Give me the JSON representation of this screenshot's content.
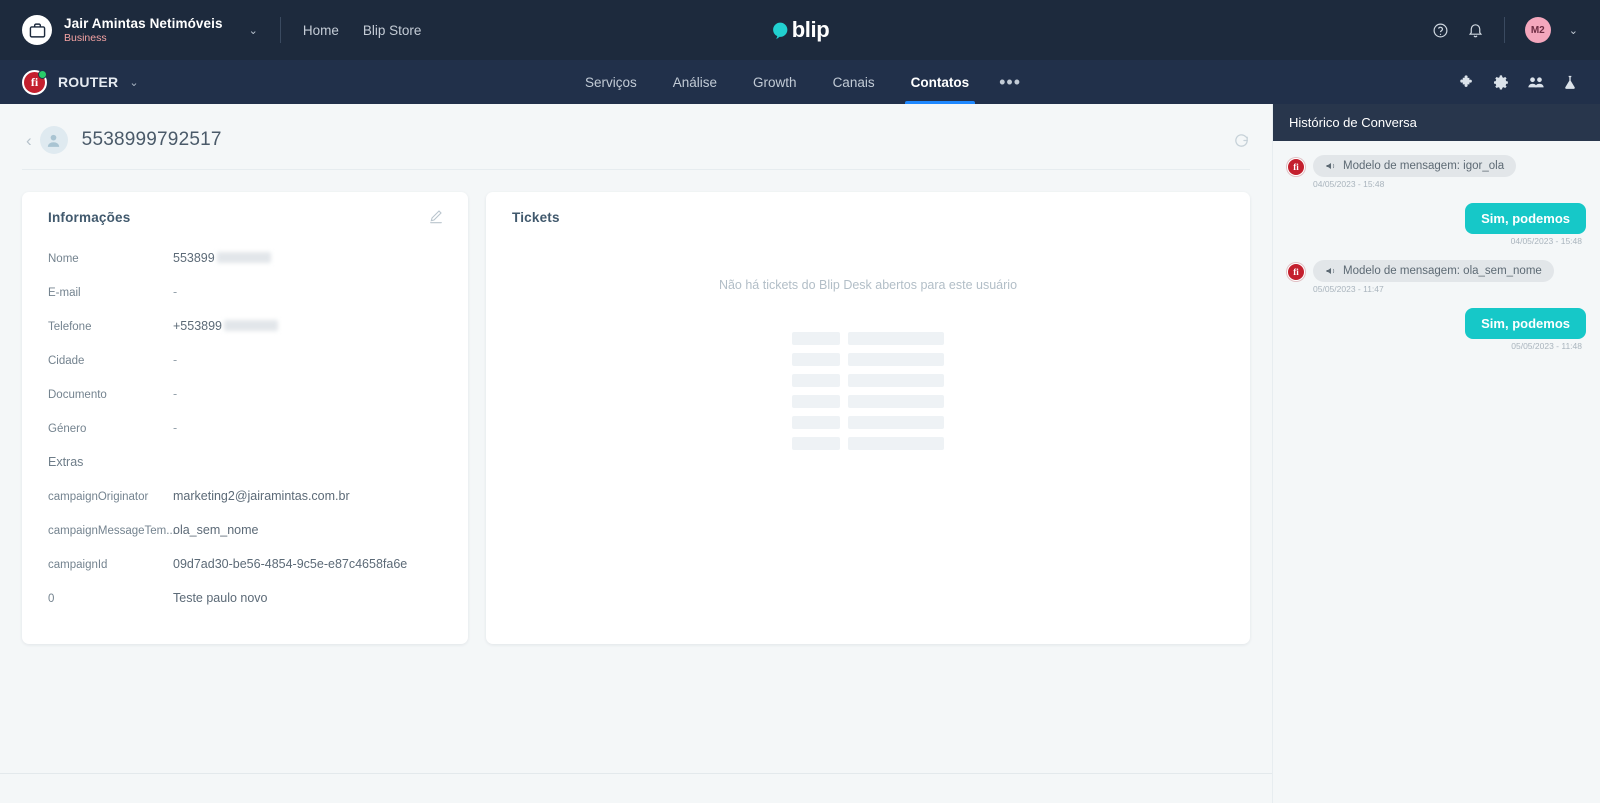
{
  "topbar": {
    "org_name": "Jair Amintas Netimóveis",
    "org_plan": "Business",
    "org_caret": "⌄",
    "links": [
      {
        "label": "Home"
      },
      {
        "label": "Blip Store"
      }
    ],
    "brand": "blip",
    "user_initials": "M2",
    "user_caret": "⌄",
    "icons": [
      "help-circle-icon",
      "bell-icon"
    ]
  },
  "botbar": {
    "bot_name": "ROUTER",
    "bot_caret": "⌄",
    "bot_glyph": "fi",
    "tabs": [
      {
        "label": "Serviços",
        "active": false
      },
      {
        "label": "Análise",
        "active": false
      },
      {
        "label": "Growth",
        "active": false
      },
      {
        "label": "Canais",
        "active": false
      },
      {
        "label": "Contatos",
        "active": true
      }
    ],
    "more_label": "•••",
    "right_icons": [
      "puzzle-icon",
      "gear-icon",
      "people-icon",
      "flask-icon"
    ],
    "active_tab_color": "#1e88ff"
  },
  "contact": {
    "title": "5538999792517",
    "back_label": "‹",
    "avatar_icon": "person-icon",
    "refresh_icon": "refresh-icon"
  },
  "info_card": {
    "title": "Informações",
    "edit_icon": "pencil-icon",
    "rows": [
      {
        "label": "Nome",
        "value": "553899",
        "redacted": true
      },
      {
        "label": "E-mail",
        "value": "-",
        "redacted": false
      },
      {
        "label": "Telefone",
        "value": "+553899",
        "redacted": true
      },
      {
        "label": "Cidade",
        "value": "-",
        "redacted": false
      },
      {
        "label": "Documento",
        "value": "-",
        "redacted": false
      },
      {
        "label": "Género",
        "value": "-",
        "redacted": false
      }
    ],
    "extras_title": "Extras",
    "extras": [
      {
        "label": "campaignOriginator",
        "value": "marketing2@jairamintas.com.br"
      },
      {
        "label": "campaignMessageTem...",
        "value": "ola_sem_nome"
      },
      {
        "label": "campaignId",
        "value": "09d7ad30-be56-4854-9c5e-e87c4658fa6e"
      },
      {
        "label": "0",
        "value": "Teste paulo novo"
      }
    ]
  },
  "tickets_card": {
    "title": "Tickets",
    "empty_message": "Não há tickets do Blip Desk abertos para este usuário",
    "skeleton_rows": 6
  },
  "history": {
    "title": "Histórico de Conversa",
    "messages": [
      {
        "direction": "in",
        "icon": "megaphone-icon",
        "text": "Modelo de mensagem: igor_ola",
        "timestamp": "04/05/2023 - 15:48"
      },
      {
        "direction": "out",
        "text": "Sim, podemos",
        "timestamp": "04/05/2023 - 15:48"
      },
      {
        "direction": "in",
        "icon": "megaphone-icon",
        "text": "Modelo de mensagem: ola_sem_nome",
        "timestamp": "05/05/2023 - 11:47"
      },
      {
        "direction": "out",
        "text": "Sim, podemos",
        "timestamp": "05/05/2023 - 11:48"
      }
    ]
  },
  "colors": {
    "topbar_bg": "#1d2a3d",
    "botbar_bg": "#21304a",
    "accent_blue": "#1e88ff",
    "accent_teal": "#16c8c8",
    "brand_red": "#c4202e",
    "page_bg": "#f4f7f8"
  }
}
